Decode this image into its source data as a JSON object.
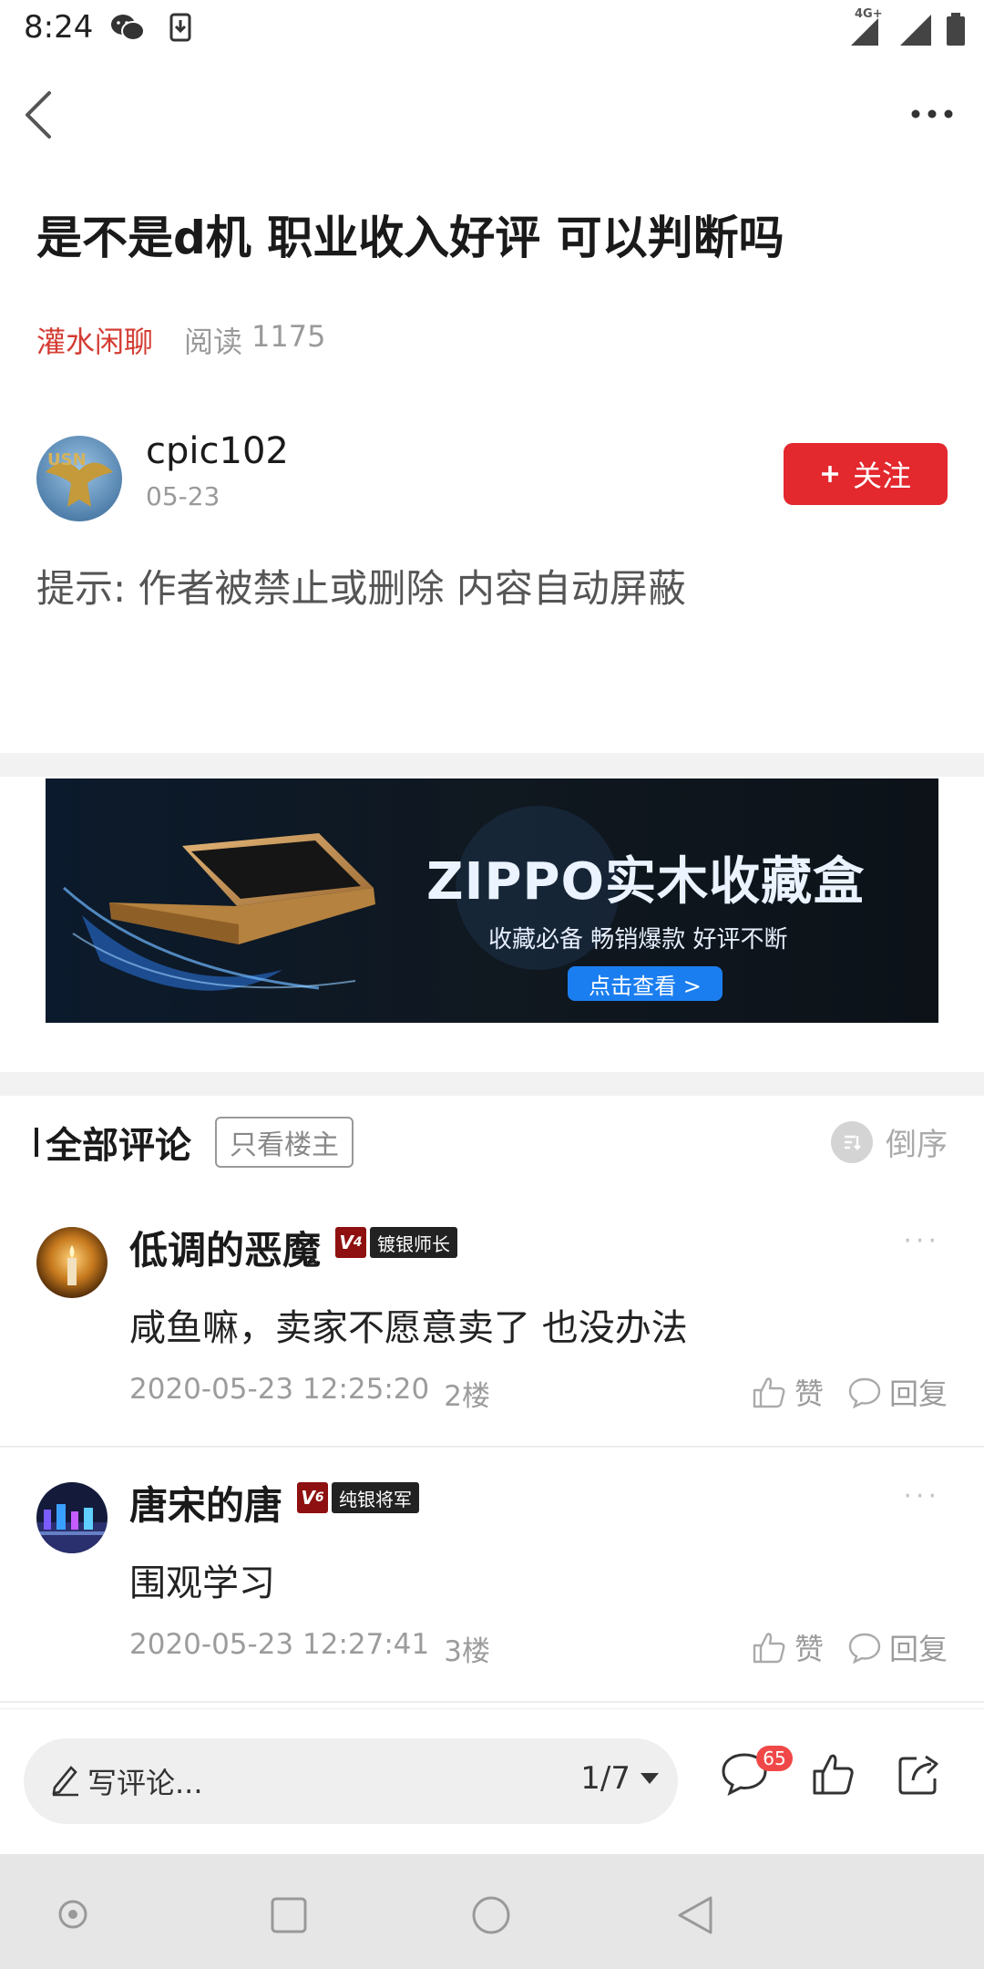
{
  "status": {
    "time": "8:24",
    "network": "4G+"
  },
  "post": {
    "title": "是不是d机 职业收入好评 可以判断吗",
    "forum": "灌水闲聊",
    "read_label": "阅读",
    "read_count": "1175",
    "author": "cpic102",
    "date": "05-23",
    "follow_label": "关注",
    "notice": "提示: 作者被禁止或删除 内容自动屏蔽"
  },
  "ad": {
    "title": "ZIPPO实木收藏盒",
    "subtitle": "收藏必备 畅销爆款 好评不断",
    "cta": "点击查看 >"
  },
  "comments_section": {
    "title": "全部评论",
    "op_only": "只看楼主",
    "sort": "倒序",
    "like_label": "赞",
    "reply_label": "回复"
  },
  "comments": [
    {
      "user": "低调的恶魔",
      "level": "4",
      "rank": "镀银师长",
      "body": "咸鱼嘛，卖家不愿意卖了 也没办法",
      "time": "2020-05-23 12:25:20",
      "floor": "2楼"
    },
    {
      "user": "唐宋的唐",
      "level": "6",
      "rank": "纯银将军",
      "body": "围观学习",
      "time": "2020-05-23 12:27:41",
      "floor": "3楼"
    }
  ],
  "bottom_bar": {
    "write_placeholder": "写评论...",
    "page": "1/7",
    "comment_count": "65"
  },
  "colors": {
    "accent": "#e3282e",
    "forum_tag": "#d43c33",
    "cta_blue": "#1b7ef0"
  }
}
